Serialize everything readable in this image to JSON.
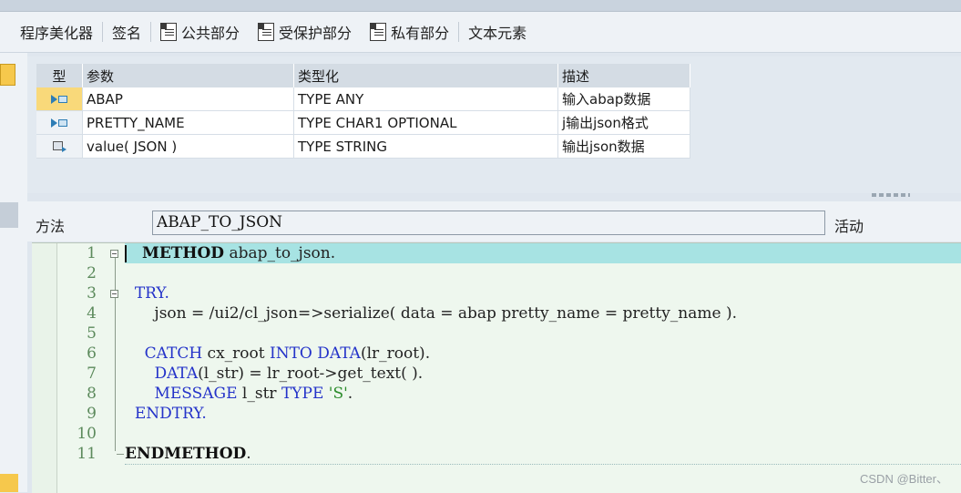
{
  "toolbar": {
    "items": [
      {
        "label": "程序美化器",
        "icon": null
      },
      {
        "label": "签名",
        "icon": null
      },
      {
        "label": "公共部分",
        "icon": "section-doc-icon"
      },
      {
        "label": "受保护部分",
        "icon": "section-doc-icon"
      },
      {
        "label": "私有部分",
        "icon": "section-doc-icon"
      },
      {
        "label": "文本元素",
        "icon": null
      }
    ]
  },
  "params": {
    "headers": [
      "型",
      "参数",
      "类型化",
      "描述"
    ],
    "rows": [
      {
        "kind": "importing",
        "name": "ABAP",
        "typing": "TYPE ANY",
        "desc": "输入abap数据",
        "selected": true
      },
      {
        "kind": "importing",
        "name": "PRETTY_NAME",
        "typing": "TYPE CHAR1 OPTIONAL",
        "desc": "j输出json格式",
        "selected": false
      },
      {
        "kind": "returning",
        "name": "value( JSON )",
        "typing": "TYPE STRING",
        "desc": "输出json数据",
        "selected": false
      }
    ]
  },
  "method": {
    "label": "方法",
    "name": "ABAP_TO_JSON",
    "status": "活动"
  },
  "editor": {
    "line_numbers": [
      "1",
      "2",
      "3",
      "4",
      "5",
      "6",
      "7",
      "8",
      "9",
      "10",
      "11"
    ],
    "lines": {
      "l1": {
        "kw": "METHOD",
        "rest": " abap_to_json."
      },
      "l3": {
        "indent": "  ",
        "kw": "TRY."
      },
      "l4": {
        "text": "      json = /ui2/cl_json=>serialize( data = abap pretty_name = pretty_name )."
      },
      "l6": {
        "indent": "    ",
        "kw1": "CATCH",
        "mid": " cx_root ",
        "kw2": "INTO DATA",
        "rest": "(lr_root)."
      },
      "l7": {
        "indent": "      ",
        "kw": "DATA",
        "rest": "(l_str) = lr_root->get_text( )."
      },
      "l8": {
        "indent": "      ",
        "kw1": "MESSAGE",
        "mid": " l_str ",
        "kw2": "TYPE",
        "sp": " ",
        "str": "'S'",
        "rest": "."
      },
      "l9": {
        "indent": "  ",
        "kw": "ENDTRY."
      },
      "l11": {
        "kw": "ENDMETHOD",
        "rest": "."
      }
    }
  },
  "watermark": "CSDN @Bitter、",
  "colors": {
    "current_line": "#a7e3e3",
    "keyword": "#2433c9",
    "string": "#2a8b2a",
    "selected_row": "#f9d97a"
  }
}
